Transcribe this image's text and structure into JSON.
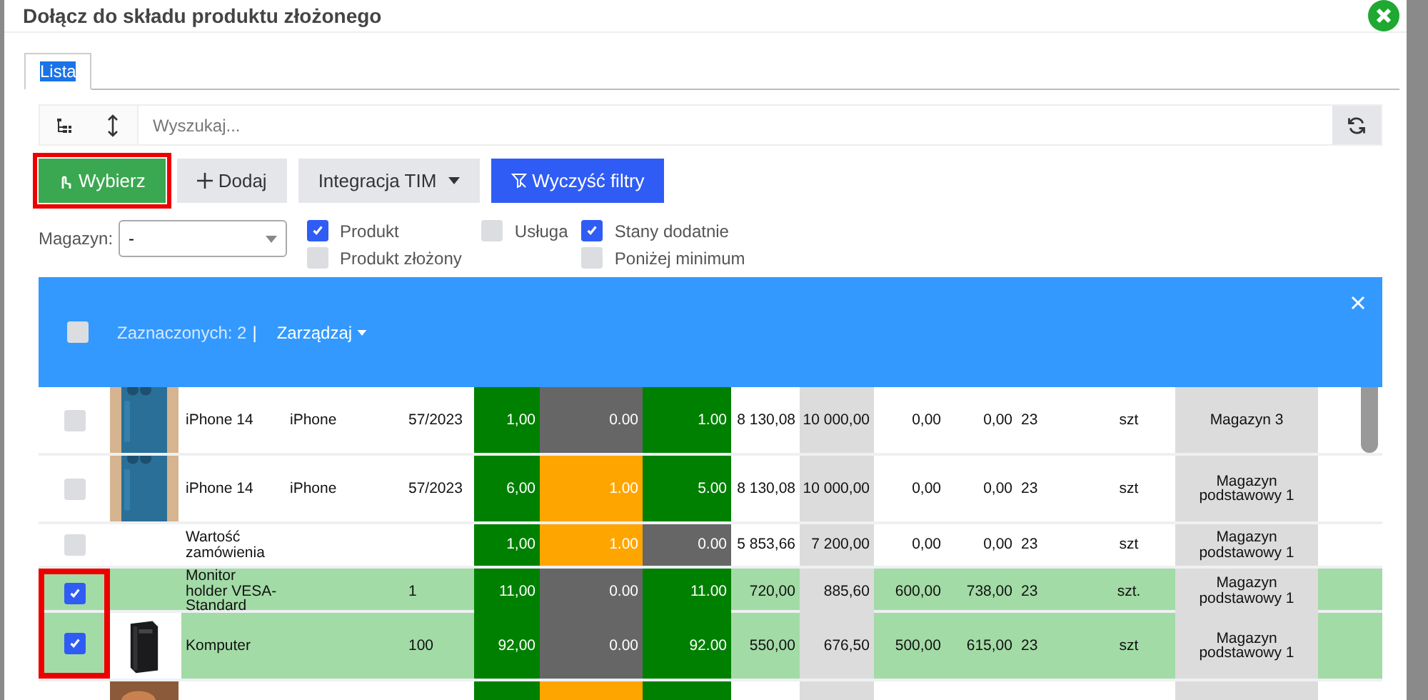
{
  "dialog": {
    "title": "Dołącz do składu produktu złożonego"
  },
  "tabs": [
    {
      "label": "Lista",
      "selected": true
    }
  ],
  "search": {
    "placeholder": "Wyszukaj..."
  },
  "buttons": [
    {
      "label": "Wybierz",
      "kind": "success",
      "outlined": true
    },
    {
      "label": "Dodaj",
      "kind": "add",
      "outlined": false
    },
    {
      "label": "Integracja TIM",
      "kind": "dropdown",
      "outlined": false
    },
    {
      "label": "Wyczyść filtry",
      "kind": "filter",
      "outlined": false
    }
  ],
  "warehouse_filter": {
    "label": "Magazyn:",
    "value": "-"
  },
  "filter_groups": [
    [
      {
        "label": "Produkt",
        "checked": true
      },
      {
        "label": "Produkt złożony",
        "checked": false
      }
    ],
    [
      {
        "label": "Usługa",
        "checked": false
      }
    ],
    [
      {
        "label": "Stany dodatnie",
        "checked": true
      },
      {
        "label": "Poniżej minimum",
        "checked": false
      }
    ]
  ],
  "selection_bar": {
    "all_checked": false,
    "count_text": "Zaznaczonych: 2",
    "separator": "|",
    "menu": "Zarządzaj"
  },
  "rows": [
    {
      "selected": false,
      "marked": false,
      "name": "iPhone 14",
      "brand": "iPhone",
      "code": "57/2023",
      "quantity": {
        "text": "1,00",
        "color": "#008000"
      },
      "reserved": {
        "text": "0.00",
        "color": "#666666"
      },
      "available": {
        "text": "1.00",
        "color": "#008000"
      },
      "net": "8 130,08",
      "gross": "10 000,00",
      "column_11": "0,00",
      "column_12": "0,00",
      "vat": "23",
      "unit": "szt",
      "warehouse": "Magazyn 3"
    },
    {
      "selected": false,
      "marked": false,
      "name": "iPhone 14",
      "brand": "iPhone",
      "code": "57/2023",
      "quantity": {
        "text": "6,00",
        "color": "#008000"
      },
      "reserved": {
        "text": "1.00",
        "color": "#ffa500"
      },
      "available": {
        "text": "5.00",
        "color": "#008000"
      },
      "net": "8 130,08",
      "gross": "10 000,00",
      "column_11": "0,00",
      "column_12": "0,00",
      "vat": "23",
      "unit": "szt",
      "warehouse": "Magazyn podstawowy 1"
    },
    {
      "selected": false,
      "marked": false,
      "name": "Wartość zamówienia",
      "quantity": {
        "text": "1,00",
        "color": "#008000"
      },
      "reserved": {
        "text": "1.00",
        "color": "#ffa500"
      },
      "available": {
        "text": "0.00",
        "color": "#666666"
      },
      "net": "5 853,66",
      "gross": "7 200,00",
      "column_11": "0,00",
      "column_12": "0,00",
      "vat": "23",
      "unit": "szt",
      "warehouse": "Magazyn podstawowy 1"
    },
    {
      "selected": true,
      "marked": true,
      "name": "Monitor holder VESA-Standard",
      "code": "1",
      "quantity": {
        "text": "11,00",
        "color": "#008000"
      },
      "reserved": {
        "text": "0.00",
        "color": "#666666"
      },
      "available": {
        "text": "11.00",
        "color": "#008000"
      },
      "net": "720,00",
      "gross": "885,60",
      "column_11": "600,00",
      "column_12": "738,00",
      "vat": "23",
      "unit": "szt.",
      "warehouse": "Magazyn podstawowy 1"
    },
    {
      "selected": true,
      "marked": true,
      "name": "Komputer",
      "code": "100",
      "quantity": {
        "text": "92,00",
        "color": "#008000"
      },
      "reserved": {
        "text": "0.00",
        "color": "#666666"
      },
      "available": {
        "text": "92.00",
        "color": "#008000"
      },
      "net": "550,00",
      "gross": "676,50",
      "column_11": "500,00",
      "column_12": "615,00",
      "vat": "23",
      "unit": "szt",
      "warehouse": "Magazyn podstawowy 1"
    },
    {
      "selected": false,
      "marked": false,
      "quantity": {
        "color": "#008000"
      },
      "reserved": {
        "color": "#ffa500"
      },
      "available": {
        "color": "#008000"
      }
    }
  ]
}
